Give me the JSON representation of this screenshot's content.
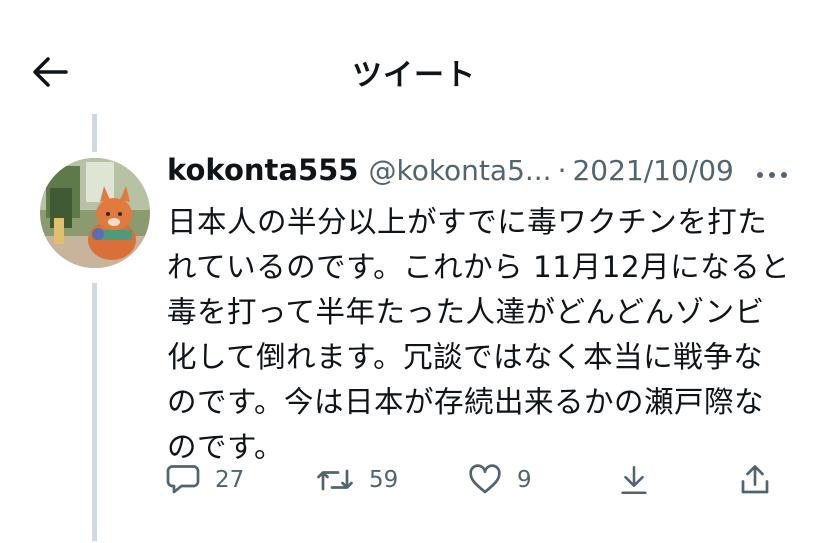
{
  "header": {
    "title": "ツイート"
  },
  "tweet": {
    "display_name": "kokonta555",
    "handle": "@kokonta5...",
    "separator": "·",
    "date": "2021/10/09",
    "text_lines": [
      "日本人の半分以上がすでに毒ワクチンを打た",
      "れているのです。これから 11月12月になると",
      "毒を打って半年たった人達がどんどんゾンビ",
      "化して倒れます。冗談ではなく本当に戦争な",
      "のです。今は日本が存続出来るかの瀬戸際な",
      "のです。"
    ]
  },
  "actions": {
    "reply_count": "27",
    "retweet_count": "59",
    "like_count": "9"
  },
  "icons": {
    "back": "back-arrow-icon",
    "more": "more-dots-icon",
    "reply": "reply-bubble-icon",
    "retweet": "retweet-icon",
    "like": "heart-icon",
    "download": "download-icon",
    "share": "share-icon"
  },
  "colors": {
    "text": "#0f1419",
    "muted": "#536471",
    "thread_line": "#cfd9de"
  }
}
